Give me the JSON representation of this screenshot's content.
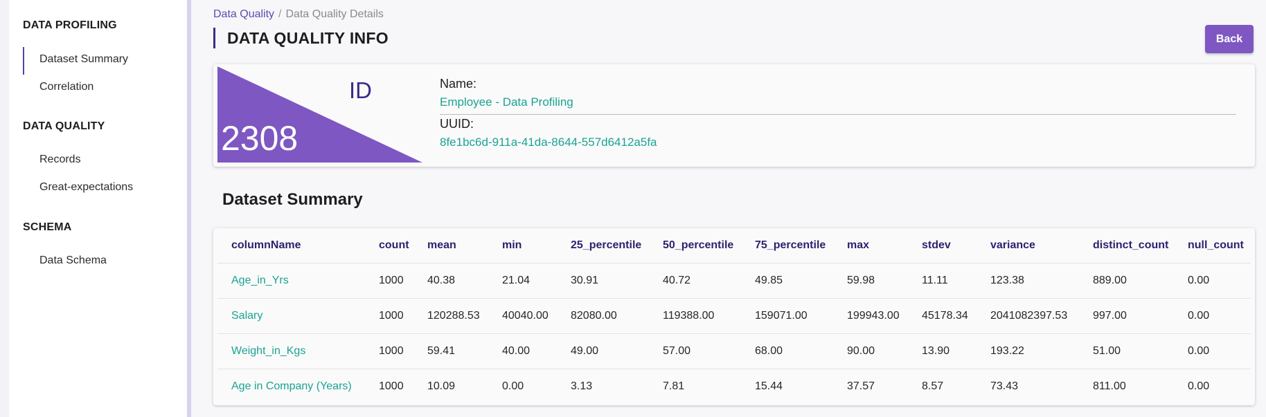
{
  "colors": {
    "accent": "#7e57c2",
    "link_teal": "#1aa391",
    "header_purple": "#2e1f6e"
  },
  "sidebar": {
    "sections": [
      {
        "title": "DATA PROFILING",
        "items": [
          "Dataset Summary",
          "Correlation"
        ]
      },
      {
        "title": "DATA QUALITY",
        "items": [
          "Records",
          "Great-expectations"
        ]
      },
      {
        "title": "SCHEMA",
        "items": [
          "Data Schema"
        ]
      }
    ],
    "active_item": "Dataset Summary"
  },
  "breadcrumb": {
    "link": "Data Quality",
    "separator": "/",
    "current": "Data Quality Details"
  },
  "page_title": "DATA QUALITY INFO",
  "back_button": "Back",
  "info": {
    "id_label": "ID",
    "id_value": "2308",
    "name_label": "Name:",
    "name_value": "Employee - Data Profiling",
    "uuid_label": "UUID:",
    "uuid_value": "8fe1bc6d-911a-41da-8644-557d6412a5fa"
  },
  "summary": {
    "heading": "Dataset Summary",
    "columns": [
      "columnName",
      "count",
      "mean",
      "min",
      "25_percentile",
      "50_percentile",
      "75_percentile",
      "max",
      "stdev",
      "variance",
      "distinct_count",
      "null_count"
    ],
    "rows": [
      [
        "Age_in_Yrs",
        "1000",
        "40.38",
        "21.04",
        "30.91",
        "40.72",
        "49.85",
        "59.98",
        "11.11",
        "123.38",
        "889.00",
        "0.00"
      ],
      [
        "Salary",
        "1000",
        "120288.53",
        "40040.00",
        "82080.00",
        "119388.00",
        "159071.00",
        "199943.00",
        "45178.34",
        "2041082397.53",
        "997.00",
        "0.00"
      ],
      [
        "Weight_in_Kgs",
        "1000",
        "59.41",
        "40.00",
        "49.00",
        "57.00",
        "68.00",
        "90.00",
        "13.90",
        "193.22",
        "51.00",
        "0.00"
      ],
      [
        "Age in Company (Years)",
        "1000",
        "10.09",
        "0.00",
        "3.13",
        "7.81",
        "15.44",
        "37.57",
        "8.57",
        "73.43",
        "811.00",
        "0.00"
      ]
    ]
  }
}
